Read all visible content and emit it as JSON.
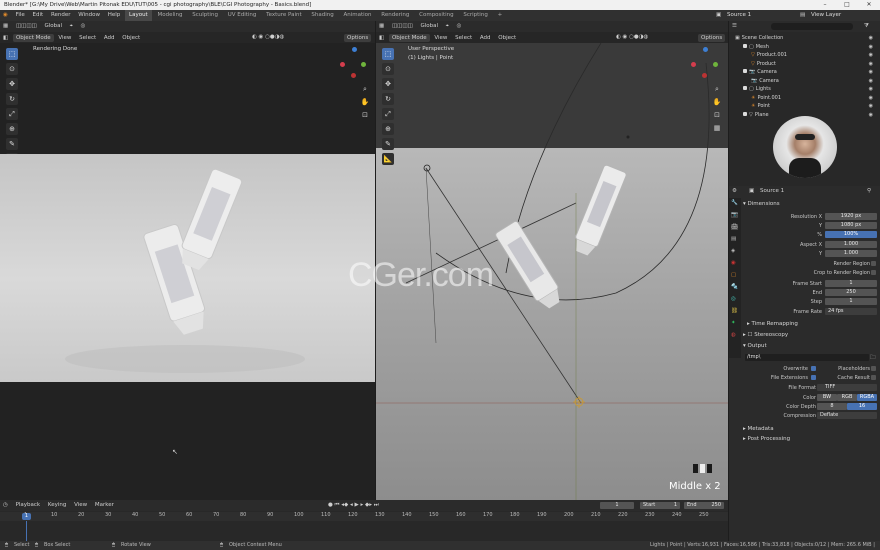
{
  "title_bar": {
    "text": "Blender* [G:\\My Drive\\Web\\Martin Pitonak EDU\\TUT\\005 - cgi photography\\BLE\\CGI Photography - Basics.blend]"
  },
  "menu": [
    "File",
    "Edit",
    "Render",
    "Window",
    "Help"
  ],
  "workspaces": [
    "Layout",
    "Modeling",
    "Sculpting",
    "UV Editing",
    "Texture Paint",
    "Shading",
    "Animation",
    "Rendering",
    "Compositing",
    "Scripting"
  ],
  "scene_name": "Source 1",
  "view_layer": "View Layer",
  "left_viewport": {
    "mode": "Object Mode",
    "menus": [
      "View",
      "Select",
      "Add",
      "Object"
    ],
    "status": "Rendering Done",
    "options": "Options"
  },
  "right_viewport": {
    "mode": "Object Mode",
    "menus": [
      "View",
      "Select",
      "Add",
      "Object"
    ],
    "transform": "Global",
    "perspective": "User Perspective",
    "collection": "(1) Lights | Point",
    "options": "Options",
    "overlay_text": "Middle x 2"
  },
  "transform_left": "Global",
  "watermark": "CGer.com",
  "outliner": {
    "items": [
      {
        "label": "Scene Collection",
        "indent": 0
      },
      {
        "label": "Mesh",
        "indent": 1
      },
      {
        "label": "Product.001",
        "indent": 2
      },
      {
        "label": "Product",
        "indent": 2
      },
      {
        "label": "Camera",
        "indent": 1
      },
      {
        "label": "Camera",
        "indent": 2
      },
      {
        "label": "Lights",
        "indent": 1
      },
      {
        "label": "Point.001",
        "indent": 2
      },
      {
        "label": "Point",
        "indent": 2
      },
      {
        "label": "Plane",
        "indent": 1
      }
    ]
  },
  "properties": {
    "header": "Source 1",
    "dimensions_title": "Dimensions",
    "resolution_x_label": "Resolution X",
    "resolution_x": "1920 px",
    "y_label": "Y",
    "resolution_y": "1080 px",
    "pct_label": "%",
    "resolution_pct": "100%",
    "aspect_x_label": "Aspect X",
    "aspect_x": "1.000",
    "aspect_y": "1.000",
    "render_region": "Render Region",
    "crop_region": "Crop to Render Region",
    "frame_start_label": "Frame Start",
    "frame_start": "1",
    "end_label": "End",
    "frame_end": "250",
    "step_label": "Step",
    "frame_step": "1",
    "frame_rate_label": "Frame Rate",
    "frame_rate": "24 fps",
    "time_remap": "Time Remapping",
    "stereoscopy": "Stereoscopy",
    "output_title": "Output",
    "output_path": "/tmp\\",
    "overwrite": "Overwrite",
    "placeholders": "Placeholders",
    "file_ext": "File Extensions",
    "cache_result": "Cache Result",
    "file_format_label": "File Format",
    "file_format": "TIFF",
    "color_label": "Color",
    "color_bw": "BW",
    "color_rgb": "RGB",
    "color_rgba": "RGBA",
    "color_depth_label": "Color Depth",
    "depth_8": "8",
    "depth_16": "16",
    "compression_label": "Compression",
    "compression": "Deflate",
    "metadata": "Metadata",
    "post_processing": "Post Processing"
  },
  "timeline": {
    "menus": [
      "Playback",
      "Keying",
      "View",
      "Marker"
    ],
    "current_frame": "1",
    "start_label": "Start",
    "start": "1",
    "end_label": "End",
    "end": "250",
    "ticks": [
      "1",
      "10",
      "20",
      "30",
      "40",
      "50",
      "60",
      "70",
      "80",
      "90",
      "100",
      "110",
      "120",
      "130",
      "140",
      "150",
      "160",
      "170",
      "180",
      "190",
      "200",
      "210",
      "220",
      "230",
      "240",
      "250"
    ]
  },
  "status_bar": {
    "select": "Select",
    "box_select": "Box Select",
    "rotate": "Rotate View",
    "context": "Object Context Menu",
    "stats": "Lights | Point | Verts:16,931 | Faces:16,586 | Tris:33,818 | Objects:0/12 | Mem: 265.6 MiB | v2.81.16"
  },
  "colors": {
    "accent": "#4772b3",
    "header": "#2b2b2b",
    "panel": "#303030"
  }
}
